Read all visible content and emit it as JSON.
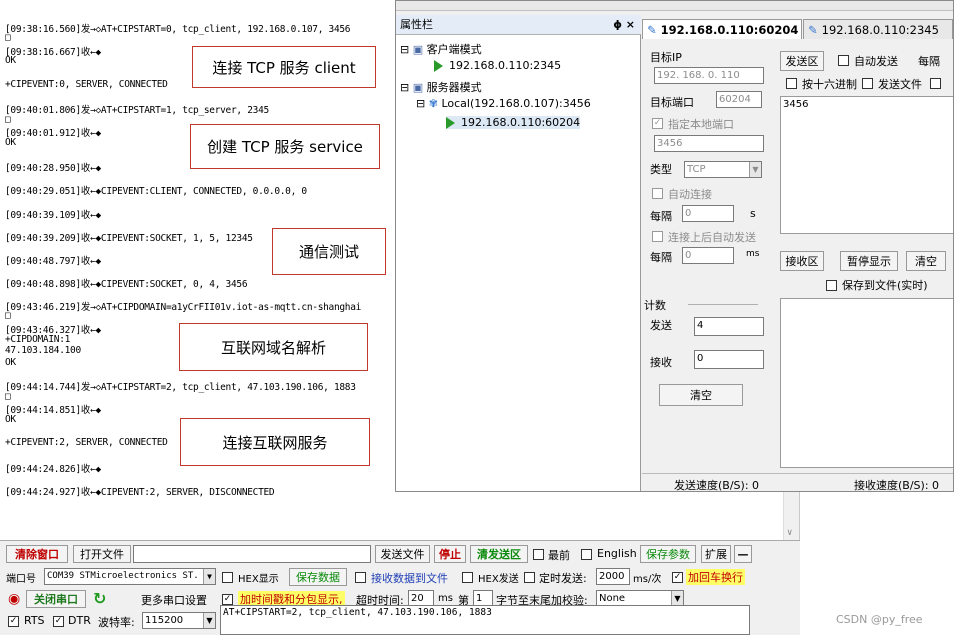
{
  "log": {
    "lines": [
      "[09:38:16.560]发→◇AT+CIPSTART=0, tcp_client, 192.168.0.107, 3456",
      "□",
      "[09:38:16.667]收←◆",
      "OK",
      "+CIPEVENT:0, SERVER, CONNECTED",
      "[09:40:01.806]发→◇AT+CIPSTART=1, tcp_server, 2345",
      "□",
      "[09:40:01.912]收←◆",
      "OK",
      "[09:40:28.950]收←◆",
      "[09:40:29.051]收←◆CIPEVENT:CLIENT, CONNECTED, 0.0.0.0, 0",
      "[09:40:39.109]收←◆",
      "[09:40:39.209]收←◆CIPEVENT:SOCKET, 1, 5, 12345",
      "[09:40:48.797]收←◆",
      "[09:40:48.898]收←◆CIPEVENT:SOCKET, 0, 4, 3456",
      "[09:43:46.219]发→◇AT+CIPDOMAIN=a1yCrFII01v.iot-as-mqtt.cn-shanghai",
      "□",
      "[09:43:46.327]收←◆",
      "+CIPDOMAIN:1",
      "47.103.184.100",
      "OK",
      "[09:44:14.744]发→◇AT+CIPSTART=2, tcp_client, 47.103.190.106, 1883",
      "□",
      "[09:44:14.851]收←◆",
      "OK",
      "+CIPEVENT:2, SERVER, CONNECTED",
      "[09:44:24.826]收←◆",
      "[09:44:24.927]收←◆CIPEVENT:2, SERVER, DISCONNECTED"
    ],
    "notes": [
      "连接 TCP 服务 client",
      "创建 TCP 服务 service",
      "通信测试",
      "互联网域名解析",
      "连接互联网服务"
    ]
  },
  "controls": {
    "clear_window": "清除窗口",
    "open_file": "打开文件",
    "send_file": "发送文件",
    "stop": "停止",
    "clear_send": "清发送区",
    "topmost": "最前",
    "english": "English",
    "save_params": "保存参数",
    "expand": "扩展",
    "collapse": "—",
    "port_label": "端口号",
    "port_value": "COM39 STMicroelectronics ST.",
    "hex_display": "HEX显示",
    "save_data": "保存数据",
    "recv_to_file": "接收数据到文件",
    "hex_send": "HEX发送",
    "timed_send": "定时发送:",
    "interval_value": "2000",
    "interval_unit": "ms/次",
    "append_newline": "加回车换行",
    "close_port": "关闭串口",
    "more_settings": "更多串口设置",
    "add_timestamp": "加时间戳和分包显示,",
    "timeout_label": "超时时间:",
    "timeout_value": "20",
    "timeout_unit": "ms",
    "byte_label_a": "第",
    "byte_value": "1",
    "byte_label_b": "字节至末尾加校验:",
    "checksum_value": "None",
    "rts": "RTS",
    "dtr": "DTR",
    "baud_label": "波特率:",
    "baud_value": "115200",
    "send_text": "AT+CIPSTART=2, tcp_client, 47.103.190.106, 1883"
  },
  "net": {
    "props_title": "属性栏",
    "pin": "ɸ ×",
    "client_mode": "客户端模式",
    "client_item": "192.168.0.110:2345",
    "server_mode": "服务器模式",
    "local_item": "Local(192.168.0.107):3456",
    "server_item": "192.168.0.110:60204",
    "tab_active": "192.168.0.110:60204",
    "tab_inactive": "192.168.0.110:2345",
    "target_ip_label": "目标IP",
    "target_ip": "192. 168. 0. 110",
    "target_port_label": "目标端口",
    "target_port": "60204",
    "local_port_label": "指定本地端口",
    "local_port": "3456",
    "type_label": "类型",
    "type_value": "TCP",
    "auto_connect": "自动连接",
    "every1": "每隔",
    "every1_value": "0",
    "every1_unit": "s",
    "auto_send_after": "连接上后自动发送",
    "every2": "每隔",
    "every2_value": "0",
    "every2_unit": "ms",
    "count_label": "计数",
    "send_label": "发送",
    "send_count": "4",
    "recv_label": "接收",
    "recv_count": "0",
    "clear": "清空",
    "send_area": "发送区",
    "auto_send": "自动发送",
    "every3": "每隔",
    "by_hex": "按十六进制",
    "send_file": "发送文件",
    "send_content": "3456",
    "recv_area": "接收区",
    "pause_display": "暂停显示",
    "clear2": "清空",
    "save_to_file": "保存到文件(实时)",
    "send_speed": "发送速度(B/S): 0",
    "recv_speed": "接收速度(B/S): 0"
  },
  "watermark": "CSDN @py_free"
}
